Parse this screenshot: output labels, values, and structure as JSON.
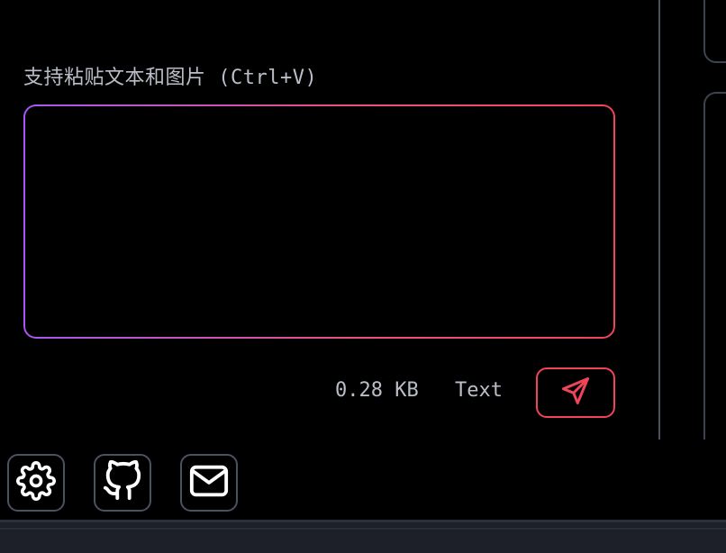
{
  "paste_area": {
    "hint": "支持粘贴文本和图片 (Ctrl+V)",
    "value": ""
  },
  "status": {
    "size": "0.28 KB",
    "type": "Text"
  },
  "colors": {
    "accent": "#f0445a",
    "gradient_start": "#a855f7",
    "border_muted": "#4b5160",
    "text_muted": "#b9bec8"
  },
  "icons": {
    "send": "send-icon",
    "settings": "gear-icon",
    "github": "github-icon",
    "mail": "mail-icon"
  }
}
